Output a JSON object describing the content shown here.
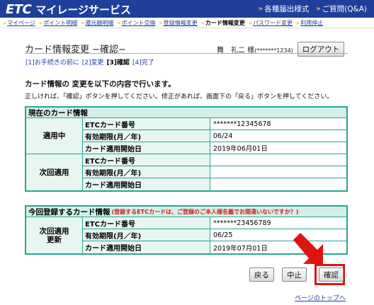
{
  "header": {
    "logo_etc": "ETC",
    "logo_text": "マイレージサービス",
    "links": [
      {
        "label": "各種届出様式"
      },
      {
        "label": "ご質問(Q&A)"
      }
    ]
  },
  "nav": {
    "items": [
      {
        "label": "マイページ"
      },
      {
        "label": "ポイント明細"
      },
      {
        "label": "還元額明細"
      },
      {
        "label": "ポイント交換"
      },
      {
        "label": "登録情報変更"
      },
      {
        "label": "カード情報変更"
      },
      {
        "label": "パスワード変更"
      },
      {
        "label": "利用停止"
      }
    ],
    "active_index": 5
  },
  "page": {
    "title": "カード情報変更 −確認−",
    "user_name": "舞　礼二 様",
    "user_id": "(*******1234)",
    "logout_label": "ログアウト",
    "steps": [
      "[1]お手続きの前に",
      "[2]変更",
      "[3]確認",
      "[4]完了"
    ],
    "current_step": 2,
    "intro_line1": "カード情報の 変更を以下の内容で行います。",
    "intro_line2": "正しければ、「確認」ボタンを押してください。修正があれば、画面下の「戻る」ボタンを押してください。"
  },
  "current_card": {
    "heading": "現在のカード情報",
    "groups": [
      {
        "label": "適用中",
        "rows": [
          {
            "label": "ETCカード番号",
            "value": "*******12345678"
          },
          {
            "label": "有効期限(月／年)",
            "value": "06/24"
          },
          {
            "label": "カード適用開始日",
            "value": "2019年06月01日"
          }
        ]
      },
      {
        "label": "次回適用",
        "rows": [
          {
            "label": "ETCカード番号",
            "value": ""
          },
          {
            "label": "有効期限(月／年)",
            "value": ""
          },
          {
            "label": "カード適用開始日",
            "value": ""
          }
        ]
      }
    ]
  },
  "new_card": {
    "heading": "今回登録するカード情報",
    "note": "(登録するETCカードは、ご登録のご本人様名義でお間違いないですか？)",
    "group_label_1": "次回適用",
    "group_label_2": "更新",
    "rows": [
      {
        "label": "ETCカード番号",
        "value": "*******23456789"
      },
      {
        "label": "有効期限(月／年)",
        "value": "06/25"
      },
      {
        "label": "カード適用開始日",
        "value": "2019年07月01日"
      }
    ]
  },
  "buttons": {
    "back": "戻る",
    "cancel": "中止",
    "confirm": "確認"
  },
  "page_top_link": "ページのトップへ",
  "colors": {
    "header_bg": "#1e3f9a",
    "accent_arrow": "#e8c22a",
    "table_border": "#2aa594",
    "table_head_bg": "#d3efe7",
    "label_bg": "#e8f6f1",
    "highlight_red": "#e0140f"
  }
}
